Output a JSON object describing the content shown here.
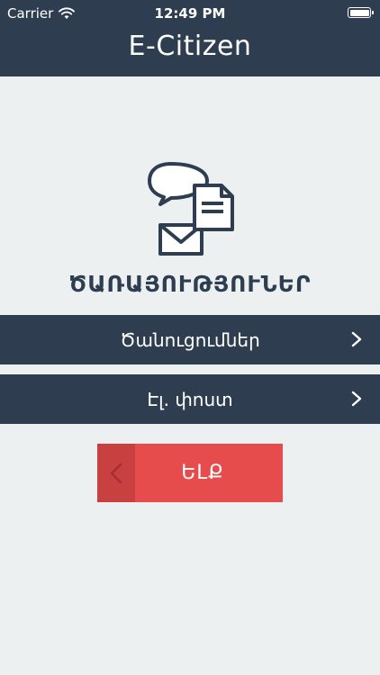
{
  "status_bar": {
    "carrier": "Carrier",
    "time": "12:49 PM"
  },
  "header": {
    "title": "E-Citizen"
  },
  "section": {
    "title": "ԾԱՌԱՅՈՒԹՅՈՒՆԵՐ"
  },
  "menu": {
    "items": [
      {
        "label": "Ծանուցումներ"
      },
      {
        "label": "Էլ. փոստ"
      }
    ]
  },
  "exit_button": {
    "label": "ԵԼՔ"
  },
  "colors": {
    "header_bg": "#2e3e50",
    "page_bg": "#ecf0f1",
    "exit_bg": "#e74c4c",
    "exit_left": "#c8403f"
  }
}
